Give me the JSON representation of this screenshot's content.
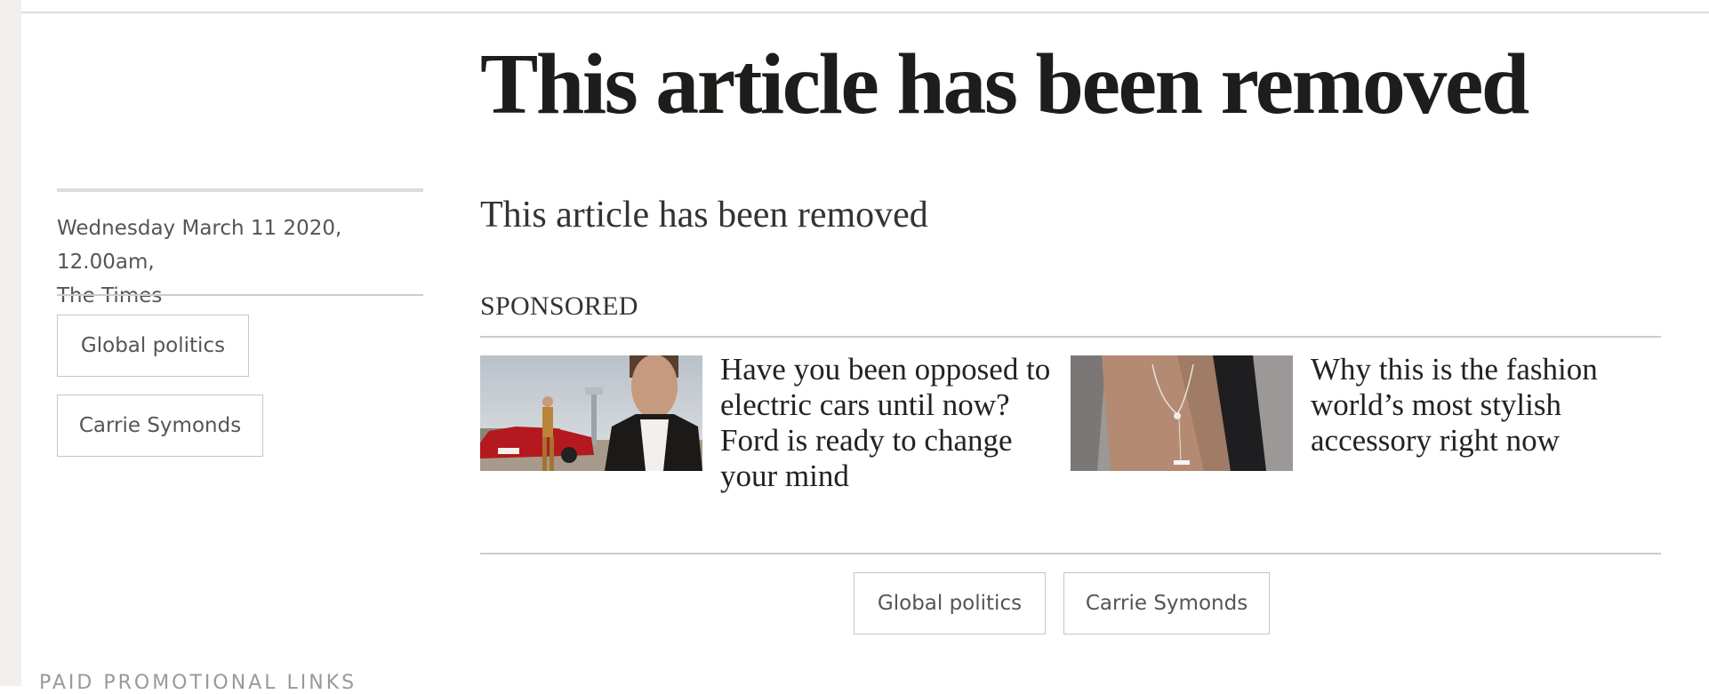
{
  "article": {
    "headline": "This article has been removed",
    "standfirst": "This article has been removed"
  },
  "meta": {
    "date_line": "Wednesday March 11 2020, 12.00am,",
    "publication": "The Times"
  },
  "tags": {
    "left": [
      "Global politics",
      "Carrie Symonds"
    ],
    "bottom": [
      "Global politics",
      "Carrie Symonds"
    ]
  },
  "sponsored": {
    "label": "SPONSORED",
    "items": [
      {
        "title": "Have you been opposed to electric cars until now? Ford is ready to change your mind",
        "image": "ford-electric-car-promo-image"
      },
      {
        "title": "Why this is the fashion world’s most stylish accessory right now",
        "image": "fashion-necklace-promo-image"
      }
    ]
  },
  "footer": {
    "paid_links_label": "PAID PROMOTIONAL LINKS"
  },
  "colors": {
    "text": "#1d1d1b",
    "muted": "#555555",
    "rule": "#cccccc",
    "gutter": "#f2efec"
  }
}
